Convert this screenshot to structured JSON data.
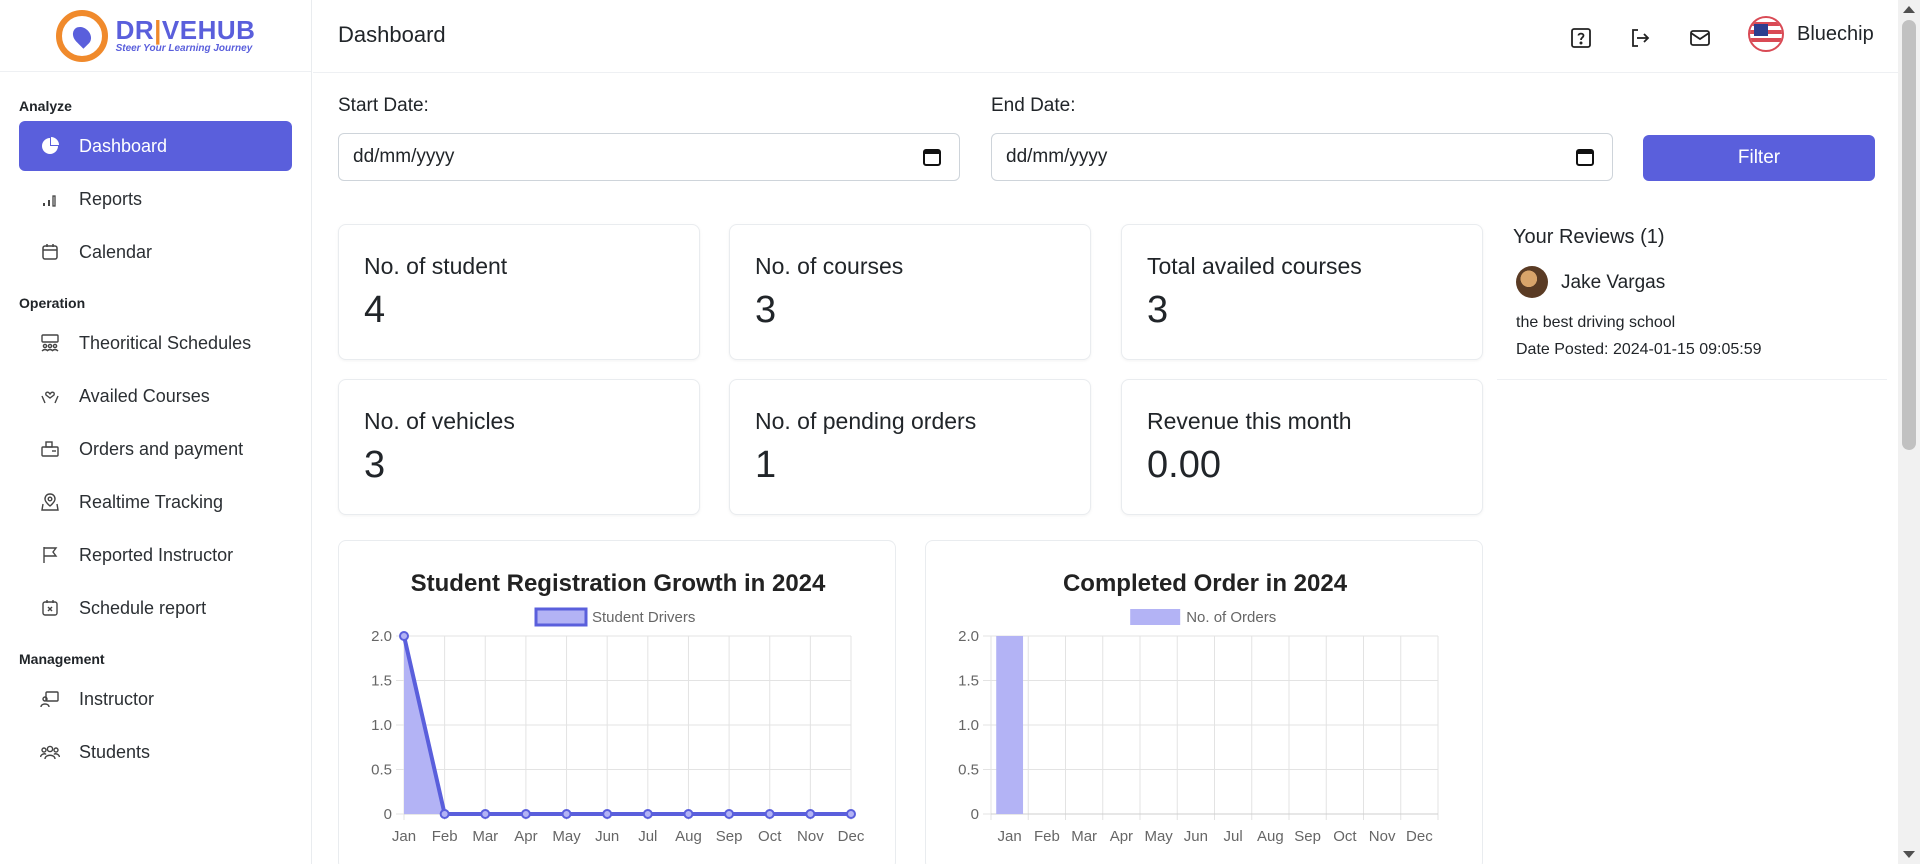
{
  "brand": {
    "name_part1": "DR",
    "name_part2": "VEHUB",
    "tagline": "Steer Your Learning Journey"
  },
  "sidebar": {
    "sections": [
      {
        "title": "Analyze",
        "items": [
          {
            "label": "Dashboard",
            "icon": "pie-chart-icon",
            "active": true
          },
          {
            "label": "Reports",
            "icon": "bar-chart-icon"
          },
          {
            "label": "Calendar",
            "icon": "calendar-icon"
          }
        ]
      },
      {
        "title": "Operation",
        "items": [
          {
            "label": "Theoritical Schedules",
            "icon": "classroom-icon"
          },
          {
            "label": "Availed Courses",
            "icon": "hand-heart-icon"
          },
          {
            "label": "Orders and payment",
            "icon": "orders-icon"
          },
          {
            "label": "Realtime Tracking",
            "icon": "map-pin-icon"
          },
          {
            "label": "Reported Instructor",
            "icon": "flag-icon"
          },
          {
            "label": "Schedule report",
            "icon": "calendar-x-icon"
          }
        ]
      },
      {
        "title": "Management",
        "items": [
          {
            "label": "Instructor",
            "icon": "instructor-icon"
          },
          {
            "label": "Students",
            "icon": "users-icon"
          }
        ]
      }
    ]
  },
  "header": {
    "title": "Dashboard",
    "user_name": "Bluechip",
    "icons": [
      "help-icon",
      "logout-icon",
      "mail-icon"
    ]
  },
  "filters": {
    "start_label": "Start Date:",
    "start_value": "dd/mm/yyyy",
    "end_label": "End Date:",
    "end_value": "dd/mm/yyyy",
    "button_label": "Filter"
  },
  "stats": [
    {
      "label": "No. of student",
      "value": "4"
    },
    {
      "label": "No. of courses",
      "value": "3"
    },
    {
      "label": "Total availed courses",
      "value": "3"
    },
    {
      "label": "No. of vehicles",
      "value": "3"
    },
    {
      "label": "No. of pending orders",
      "value": "1"
    },
    {
      "label": "Revenue this month",
      "value": "0.00"
    }
  ],
  "reviews": {
    "title": "Your Reviews (1)",
    "items": [
      {
        "name": "Jake Vargas",
        "text": "the best driving school",
        "date": "Date Posted: 2024-01-15 09:05:59"
      }
    ]
  },
  "colors": {
    "accent": "#5a5fdc",
    "series_fill": "#b3b3f5",
    "brand_orange": "#f08a2c"
  },
  "chart_data": [
    {
      "type": "area",
      "title": "Student Registration Growth in 2024",
      "categories": [
        "Jan",
        "Feb",
        "Mar",
        "Apr",
        "May",
        "Jun",
        "Jul",
        "Aug",
        "Sep",
        "Oct",
        "Nov",
        "Dec"
      ],
      "series": [
        {
          "name": "Student Drivers",
          "values": [
            2,
            0,
            0,
            0,
            0,
            0,
            0,
            0,
            0,
            0,
            0,
            0
          ]
        }
      ],
      "ylim": [
        0,
        2
      ],
      "yticks": [
        "0",
        "0.5",
        "1.0",
        "1.5",
        "2.0"
      ],
      "grid": true,
      "legend": "top"
    },
    {
      "type": "bar",
      "title": "Completed Order in 2024",
      "categories": [
        "Jan",
        "Feb",
        "Mar",
        "Apr",
        "May",
        "Jun",
        "Jul",
        "Aug",
        "Sep",
        "Oct",
        "Nov",
        "Dec"
      ],
      "series": [
        {
          "name": "No. of Orders",
          "values": [
            2,
            0,
            0,
            0,
            0,
            0,
            0,
            0,
            0,
            0,
            0,
            0
          ]
        }
      ],
      "ylim": [
        0,
        2
      ],
      "yticks": [
        "0",
        "0.5",
        "1.0",
        "1.5",
        "2.0"
      ],
      "grid": true,
      "legend": "top"
    }
  ]
}
